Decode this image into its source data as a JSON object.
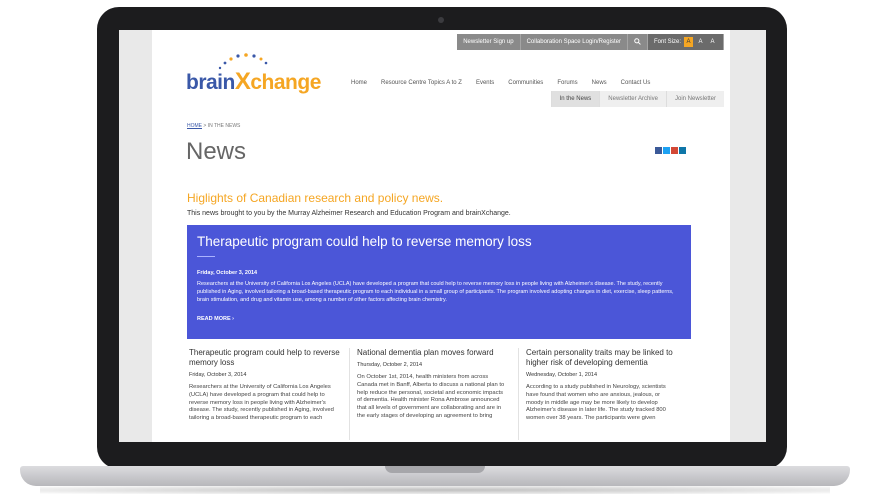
{
  "utility": {
    "newsletter": "Newsletter Sign up",
    "collab": "Collaboration Space Login/Register",
    "search_icon": "search-icon",
    "font_size_label": "Font Size:",
    "font_sizes": [
      "A",
      "A",
      "A"
    ]
  },
  "logo": {
    "part1": "brain",
    "part2": "X",
    "part3": "change"
  },
  "nav": {
    "items": [
      "Home",
      "Resource Centre Topics A to Z",
      "Events",
      "Communities",
      "Forums",
      "News",
      "Contact Us"
    ],
    "sub": [
      "In the News",
      "Newsletter Archive",
      "Join Newsletter"
    ]
  },
  "breadcrumb": {
    "home": "HOME",
    "sep": " > ",
    "current": "IN THE NEWS"
  },
  "page_title": "News",
  "social_icons": [
    "facebook-icon",
    "twitter-icon",
    "google-plus-icon",
    "linkedin-icon"
  ],
  "highlights": "Higlights of Canadian research and policy news.",
  "intro": "This news brought to you by the Murray Alzheimer Research and Education Program and brainXchange.",
  "feature": {
    "title": "Therapeutic program could help to reverse memory loss",
    "date": "Friday, October 3, 2014",
    "body": "Researchers at the University of California Los Angeles (UCLA) have developed a program that could help to reverse memory loss in people living with Alzheimer's disease. The study, recently published in Aging, involved tailoring a broad-based therapeutic program to each individual in a small group of participants. The program involved adopting changes in diet, exercise, sleep patterns, brain stimulation, and drug and vitamin use, among a number of other factors affecting brain chemistry.",
    "read_more": "READ MORE ›"
  },
  "cards": [
    {
      "title": "Therapeutic program could help to reverse memory loss",
      "date": "Friday, October 3, 2014",
      "body": "Researchers at the University of California Los Angeles (UCLA) have developed a program that could help to reverse memory loss in people living with Alzheimer's disease. The study, recently published in Aging, involved tailoring a broad-based therapeutic program to each"
    },
    {
      "title": "National dementia plan moves forward",
      "date": "Thursday, October 2, 2014",
      "body": "On October 1st, 2014, health ministers from across Canada met in Banff, Alberta to discuss a national plan to help reduce the personal, societal and economic impacts of dementia. Health minister Rona Ambrose announced that all levels of government are collaborating and are in the early stages of developing an agreement to bring"
    },
    {
      "title": "Certain personality traits may be linked to higher risk of developing dementia",
      "date": "Wednesday, October 1, 2014",
      "body": "According to a study published in Neurology, scientists have found that women who are anxious, jealous, or moody in middle age may be more likely to develop Alzheimer's disease in later life. The study tracked 800 women over 38 years. The participants were given"
    }
  ],
  "colors": {
    "brand_blue": "#3a58a8",
    "accent_orange": "#f5a623",
    "feature_bg": "#4b56d8"
  }
}
